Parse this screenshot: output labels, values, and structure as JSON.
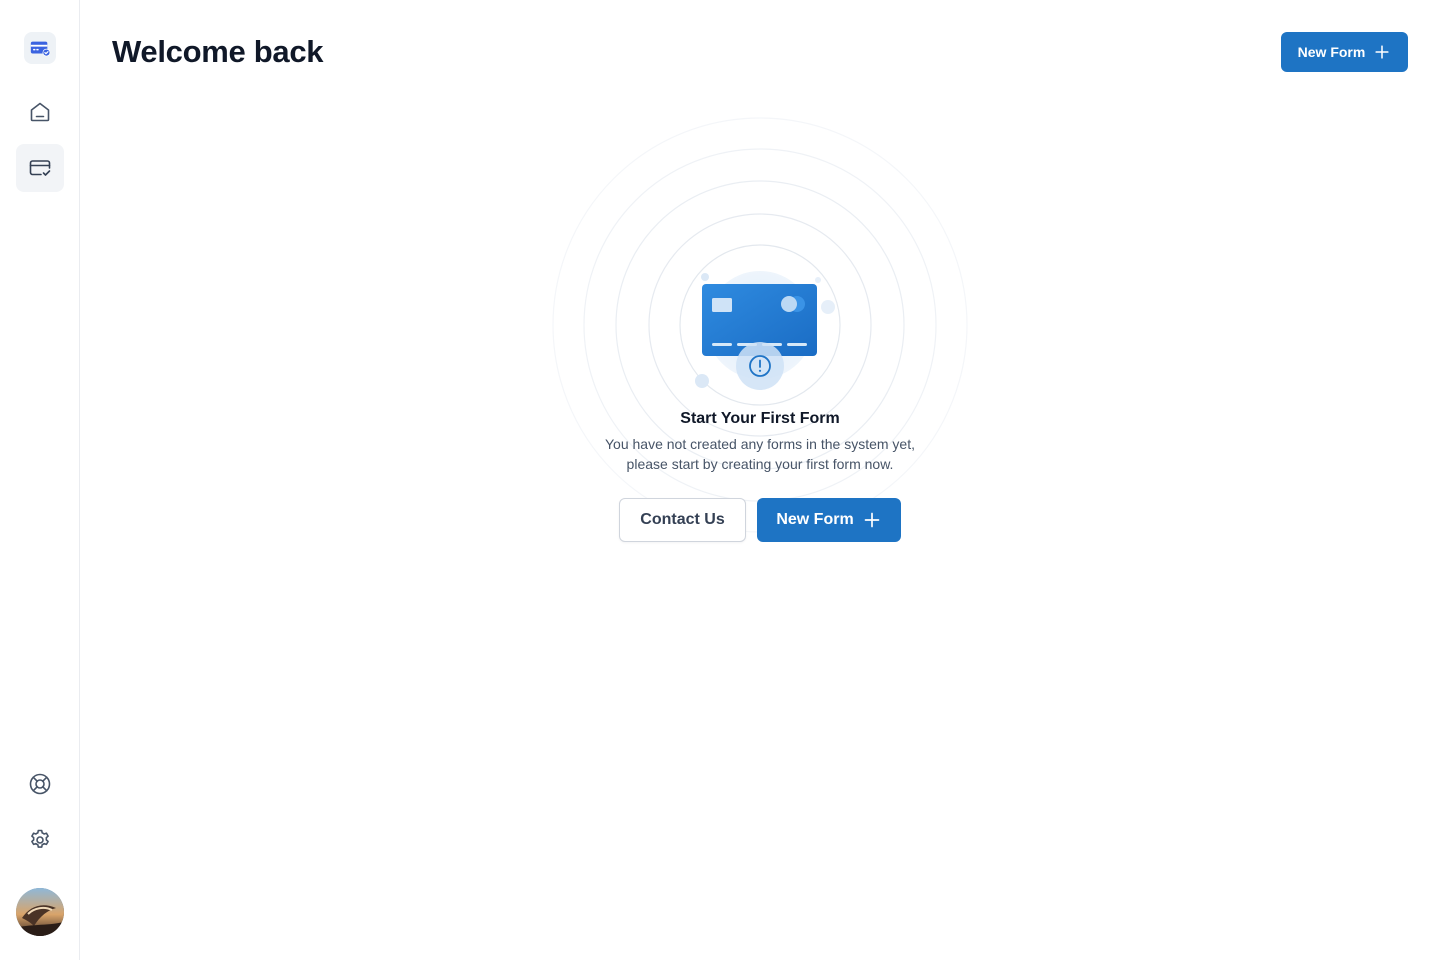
{
  "header": {
    "title": "Welcome back",
    "new_form_label": "New Form"
  },
  "sidebar": {
    "items": [
      {
        "name": "home",
        "icon": "home-icon",
        "active": false
      },
      {
        "name": "forms",
        "icon": "card-check-icon",
        "active": true
      }
    ],
    "footer_items": [
      {
        "name": "support",
        "icon": "life-buoy-icon"
      },
      {
        "name": "settings",
        "icon": "gear-icon"
      }
    ]
  },
  "empty_state": {
    "title": "Start Your First Form",
    "description_line1": "You have not created any forms in the system yet,",
    "description_line2": "please start by creating your first form now.",
    "contact_label": "Contact Us",
    "new_form_label": "New Form",
    "illustration_icon": "credit-card-alert-icon"
  },
  "colors": {
    "primary": "#1e74c4",
    "text_dark": "#101828",
    "text_muted": "#475467"
  }
}
